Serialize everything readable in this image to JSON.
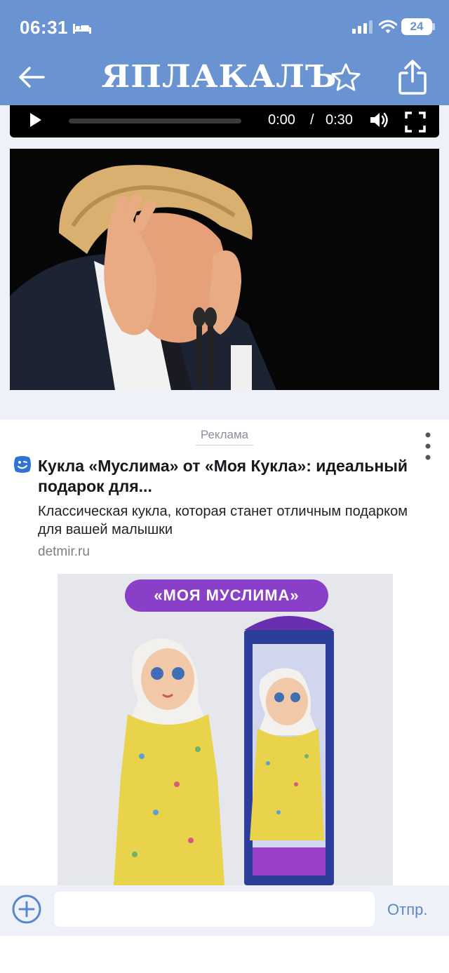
{
  "status_bar": {
    "time": "06:31",
    "battery": "24",
    "icons": [
      "bed-icon",
      "signal-icon",
      "wifi-icon",
      "battery-icon"
    ]
  },
  "nav": {
    "logo": "ЯПЛАКАЛЪ",
    "icons": [
      "back-arrow-icon",
      "star-icon",
      "share-icon"
    ]
  },
  "video_player": {
    "current_time": "0:00",
    "separator": "/",
    "total_time": "0:30",
    "progress": 0,
    "icons": [
      "play-icon",
      "volume-icon",
      "fullscreen-icon"
    ]
  },
  "ad": {
    "label": "Реклама",
    "title": "Кукла «Муслима» от «Моя Кукла»: идеальный подарок для...",
    "description": "Классическая кукла, которая станет отличным подарком для вашей малышки",
    "domain": "detmir.ru",
    "image_banner": "«МОЯ МУСЛИМА»",
    "colors": {
      "banner": "#8a3fc8",
      "dress": "#e8d34a",
      "headscarf": "#f3f1ee"
    }
  },
  "compose": {
    "placeholder": "",
    "send_label": "Отпр."
  },
  "colors": {
    "header": "#6a93d2",
    "accent": "#5b86c8"
  }
}
